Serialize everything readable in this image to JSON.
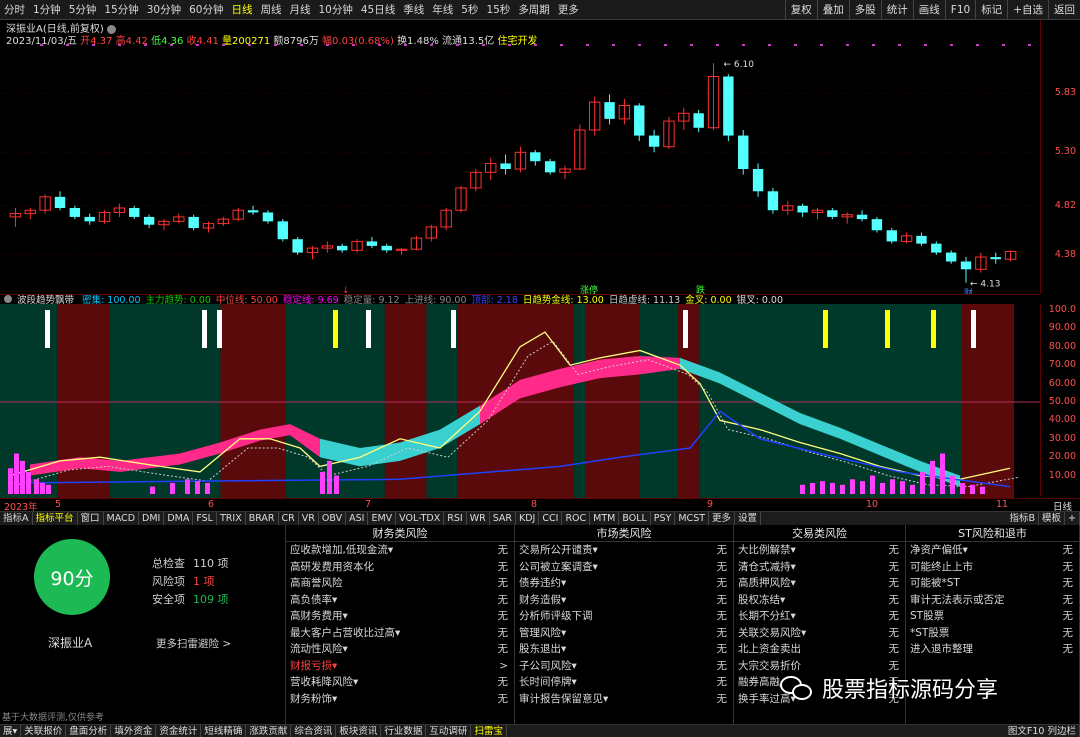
{
  "toolbar": {
    "periods": [
      "分时",
      "1分钟",
      "5分钟",
      "15分钟",
      "30分钟",
      "60分钟",
      "日线",
      "周线",
      "月线",
      "10分钟",
      "45日线",
      "季线",
      "年线",
      "5秒",
      "15秒",
      "多周期",
      "更多"
    ],
    "active_period": "日线",
    "right_tools": [
      "复权",
      "叠加",
      "多股",
      "统计",
      "画线",
      "F10",
      "标记",
      "+自选",
      "返回"
    ]
  },
  "stock": {
    "title": "深振业A(日线,前复权)",
    "info_date": "2023/11/03/五",
    "info_open": "开4.37",
    "info_high": "高4.42",
    "info_low": "低4.36",
    "info_close": "收4.41",
    "info_vol": "量200271",
    "info_amount": "额8796万",
    "info_change": "幅0.03(0.68%)",
    "info_turnover": "换1.48%",
    "info_float": "流通13.5亿",
    "info_concept": "住宅开发"
  },
  "price_axis": [
    {
      "label": "5.83",
      "value": 5.83
    },
    {
      "label": "5.30",
      "value": 5.3
    },
    {
      "label": "4.82",
      "value": 4.82
    },
    {
      "label": "4.38",
      "value": 4.38
    }
  ],
  "price_marks": {
    "high": "6.10",
    "low": "4.13"
  },
  "chart_labels": {
    "mark_zhangting": "涨停",
    "mark_die": "跌",
    "mark_cai": "财"
  },
  "indicator": {
    "name": "波段趋势飘带",
    "items": [
      {
        "t": "密集: 100.00",
        "c": "#00c8ff"
      },
      {
        "t": "主力趋势: 0.00",
        "c": "#00d000"
      },
      {
        "t": "中位线: 50.00",
        "c": "#ff4040"
      },
      {
        "t": "稳定线: 9.69",
        "c": "#ff00ff"
      },
      {
        "t": "稳定量: 9.12",
        "c": "#888888"
      },
      {
        "t": "上进线: 90.00",
        "c": "#888888"
      },
      {
        "t": "顶部: 2.18",
        "c": "#4040ff"
      },
      {
        "t": "日趋势金线: 13.00",
        "c": "#ffff00"
      },
      {
        "t": "日趋虚线: 11.13",
        "c": "#cccccc"
      },
      {
        "t": "金叉: 0.00",
        "c": "#ffff00"
      },
      {
        "t": "银叉: 0.00",
        "c": "#dddddd"
      }
    ],
    "axis": [
      {
        "label": "100.0",
        "value": 100
      },
      {
        "label": "90.00",
        "value": 90
      },
      {
        "label": "80.00",
        "value": 80
      },
      {
        "label": "70.00",
        "value": 70
      },
      {
        "label": "60.00",
        "value": 60
      },
      {
        "label": "50.00",
        "value": 50
      },
      {
        "label": "40.00",
        "value": 40
      },
      {
        "label": "30.00",
        "value": 30
      },
      {
        "label": "20.00",
        "value": 20
      },
      {
        "label": "10.00",
        "value": 10
      }
    ]
  },
  "dates": [
    "2023年",
    "5",
    "6",
    "7",
    "8",
    "9",
    "10",
    "11"
  ],
  "axis_unit": "日线",
  "indicator_tabs": [
    "指标A",
    "指标平台",
    "窗口",
    "MACD",
    "DMI",
    "DMA",
    "FSL",
    "TRIX",
    "BRAR",
    "CR",
    "VR",
    "OBV",
    "ASI",
    "EMV",
    "VOL-TDX",
    "RSI",
    "WR",
    "SAR",
    "KDJ",
    "CCI",
    "ROC",
    "MTM",
    "BOLL",
    "PSY",
    "MCST",
    "更多",
    "设置"
  ],
  "indicator_tabs_active": "指标平台",
  "indicator_tabs_right": [
    "指标B",
    "模板",
    "+"
  ],
  "score": {
    "value": "90分",
    "stock_name": "深振业A",
    "total_label": "总检查",
    "total_value": "110 项",
    "risk_label": "风险项",
    "risk_value": "1 项",
    "safe_label": "安全项",
    "safe_value": "109 项",
    "more": "更多扫雷避险 >",
    "colors": {
      "circle": "#1db954",
      "risk": "#ff4040",
      "safe": "#1db954"
    }
  },
  "risk_columns": [
    {
      "title": "财务类风险",
      "rows": [
        {
          "label": "应收款增加,低现金流▾",
          "value": "无"
        },
        {
          "label": "高研发费用资本化",
          "value": "无"
        },
        {
          "label": "高商誉风险",
          "value": "无"
        },
        {
          "label": "高负债率▾",
          "value": "无"
        },
        {
          "label": "高财务费用▾",
          "value": "无"
        },
        {
          "label": "最大客户占营收比过高▾",
          "value": "无"
        },
        {
          "label": "流动性风险▾",
          "value": "无"
        },
        {
          "label": "财报亏损▾",
          "value": ">",
          "warn": true
        },
        {
          "label": "营收耗降风险▾",
          "value": "无"
        },
        {
          "label": "财务粉饰▾",
          "value": "无"
        }
      ]
    },
    {
      "title": "市场类风险",
      "rows": [
        {
          "label": "交易所公开谴责▾",
          "value": "无"
        },
        {
          "label": "公司被立案调查▾",
          "value": "无"
        },
        {
          "label": "债券违约▾",
          "value": "无"
        },
        {
          "label": "财务造假▾",
          "value": "无"
        },
        {
          "label": "分析师评级下调",
          "value": "无"
        },
        {
          "label": "管理风险▾",
          "value": "无"
        },
        {
          "label": "股东退出▾",
          "value": "无"
        },
        {
          "label": "子公司风险▾",
          "value": "无"
        },
        {
          "label": "长时间停牌▾",
          "value": "无"
        },
        {
          "label": "审计报告保留意见▾",
          "value": "无"
        }
      ]
    },
    {
      "title": "交易类风险",
      "rows": [
        {
          "label": "大比例解禁▾",
          "value": "无"
        },
        {
          "label": "清仓式减持▾",
          "value": "无"
        },
        {
          "label": "高质押风险▾",
          "value": "无"
        },
        {
          "label": "股权冻结▾",
          "value": "无"
        },
        {
          "label": "长期不分红▾",
          "value": "无"
        },
        {
          "label": "关联交易风险▾",
          "value": "无"
        },
        {
          "label": "北上资金卖出",
          "value": "无"
        },
        {
          "label": "大宗交易折价",
          "value": "无"
        },
        {
          "label": "融券高融",
          "value": "无"
        },
        {
          "label": "换手率过高▾",
          "value": "无"
        }
      ]
    },
    {
      "title": "ST风险和退市",
      "rows": [
        {
          "label": "净资产偏低▾",
          "value": "无"
        },
        {
          "label": "可能终止上市",
          "value": "无"
        },
        {
          "label": "可能被*ST",
          "value": "无"
        },
        {
          "label": "审计无法表示或否定",
          "value": "无"
        },
        {
          "label": "ST股票",
          "value": "无"
        },
        {
          "label": "*ST股票",
          "value": "无"
        },
        {
          "label": "进入退市整理",
          "value": "无"
        }
      ]
    }
  ],
  "disclaimer": "基于大数据评测,仅供参考",
  "watermark": "股票指标源码分享",
  "status_tabs": [
    "展▾",
    "关联报价",
    "盘面分析",
    "填外资金",
    "资金统计",
    "短线精确",
    "涨跌贡献",
    "综合资讯",
    "板块资讯",
    "行业数据",
    "互动调研",
    "扫雷宝"
  ],
  "status_active": "扫雷宝",
  "status_right": "图文F10 列边栏",
  "colors": {
    "up": "#ff3030",
    "down": "#54ffff",
    "bg": "#000000",
    "axis": "#ff5050"
  },
  "chart_data": {
    "type": "candlestick",
    "title": "",
    "series": [
      {
        "name": "K线",
        "ohlc_sample": [
          [
            4.72,
            4.8,
            4.63,
            4.75
          ],
          [
            4.75,
            4.8,
            4.7,
            4.78
          ],
          [
            4.78,
            4.92,
            4.75,
            4.9
          ],
          [
            4.9,
            4.95,
            4.78,
            4.8
          ],
          [
            4.8,
            4.82,
            4.7,
            4.72
          ],
          [
            4.72,
            4.75,
            4.65,
            4.68
          ],
          [
            4.68,
            4.78,
            4.66,
            4.76
          ],
          [
            4.76,
            4.84,
            4.72,
            4.8
          ],
          [
            4.8,
            4.82,
            4.7,
            4.72
          ],
          [
            4.72,
            4.74,
            4.62,
            4.65
          ],
          [
            4.65,
            4.7,
            4.6,
            4.68
          ],
          [
            4.68,
            4.75,
            4.66,
            4.72
          ],
          [
            4.72,
            4.74,
            4.6,
            4.62
          ],
          [
            4.62,
            4.68,
            4.58,
            4.66
          ],
          [
            4.66,
            4.72,
            4.64,
            4.7
          ],
          [
            4.7,
            4.8,
            4.68,
            4.78
          ],
          [
            4.78,
            4.82,
            4.74,
            4.76
          ],
          [
            4.76,
            4.78,
            4.66,
            4.68
          ],
          [
            4.68,
            4.7,
            4.5,
            4.52
          ],
          [
            4.52,
            4.54,
            4.38,
            4.4
          ],
          [
            4.4,
            4.46,
            4.34,
            4.44
          ],
          [
            4.44,
            4.5,
            4.4,
            4.46
          ],
          [
            4.46,
            4.48,
            4.4,
            4.42
          ],
          [
            4.42,
            4.52,
            4.4,
            4.5
          ],
          [
            4.5,
            4.54,
            4.44,
            4.46
          ],
          [
            4.46,
            4.48,
            4.4,
            4.42
          ],
          [
            4.42,
            4.44,
            4.38,
            4.43
          ],
          [
            4.43,
            4.55,
            4.42,
            4.53
          ],
          [
            4.53,
            4.65,
            4.5,
            4.63
          ],
          [
            4.63,
            4.8,
            4.6,
            4.78
          ],
          [
            4.78,
            5.0,
            4.76,
            4.98
          ],
          [
            4.98,
            5.15,
            4.95,
            5.12
          ],
          [
            5.12,
            5.25,
            5.05,
            5.2
          ],
          [
            5.2,
            5.28,
            5.1,
            5.15
          ],
          [
            5.15,
            5.35,
            5.12,
            5.3
          ],
          [
            5.3,
            5.32,
            5.18,
            5.22
          ],
          [
            5.22,
            5.24,
            5.1,
            5.12
          ],
          [
            5.12,
            5.18,
            5.06,
            5.15
          ],
          [
            5.15,
            5.55,
            5.14,
            5.5
          ],
          [
            5.5,
            5.8,
            5.45,
            5.75
          ],
          [
            5.75,
            5.82,
            5.55,
            5.6
          ],
          [
            5.6,
            5.78,
            5.55,
            5.72
          ],
          [
            5.72,
            5.74,
            5.4,
            5.45
          ],
          [
            5.45,
            5.5,
            5.3,
            5.35
          ],
          [
            5.35,
            5.62,
            5.33,
            5.58
          ],
          [
            5.58,
            5.7,
            5.5,
            5.65
          ],
          [
            5.65,
            5.68,
            5.48,
            5.52
          ],
          [
            5.52,
            6.1,
            5.5,
            5.98
          ],
          [
            5.98,
            6.0,
            5.4,
            5.45
          ],
          [
            5.45,
            5.5,
            5.1,
            5.15
          ],
          [
            5.15,
            5.2,
            4.9,
            4.95
          ],
          [
            4.95,
            4.98,
            4.75,
            4.78
          ],
          [
            4.78,
            4.86,
            4.74,
            4.82
          ],
          [
            4.82,
            4.84,
            4.72,
            4.76
          ],
          [
            4.76,
            4.8,
            4.7,
            4.78
          ],
          [
            4.78,
            4.8,
            4.7,
            4.72
          ],
          [
            4.72,
            4.76,
            4.66,
            4.74
          ],
          [
            4.74,
            4.78,
            4.68,
            4.7
          ],
          [
            4.7,
            4.72,
            4.58,
            4.6
          ],
          [
            4.6,
            4.62,
            4.48,
            4.5
          ],
          [
            4.5,
            4.58,
            4.48,
            4.55
          ],
          [
            4.55,
            4.58,
            4.46,
            4.48
          ],
          [
            4.48,
            4.5,
            4.38,
            4.4
          ],
          [
            4.4,
            4.42,
            4.3,
            4.32
          ],
          [
            4.32,
            4.36,
            4.13,
            4.25
          ],
          [
            4.25,
            4.4,
            4.22,
            4.36
          ],
          [
            4.36,
            4.4,
            4.3,
            4.34
          ],
          [
            4.34,
            4.42,
            4.32,
            4.41
          ]
        ]
      }
    ],
    "ylim": [
      4.1,
      6.2
    ],
    "indicator_ylim": [
      0,
      100
    ]
  }
}
